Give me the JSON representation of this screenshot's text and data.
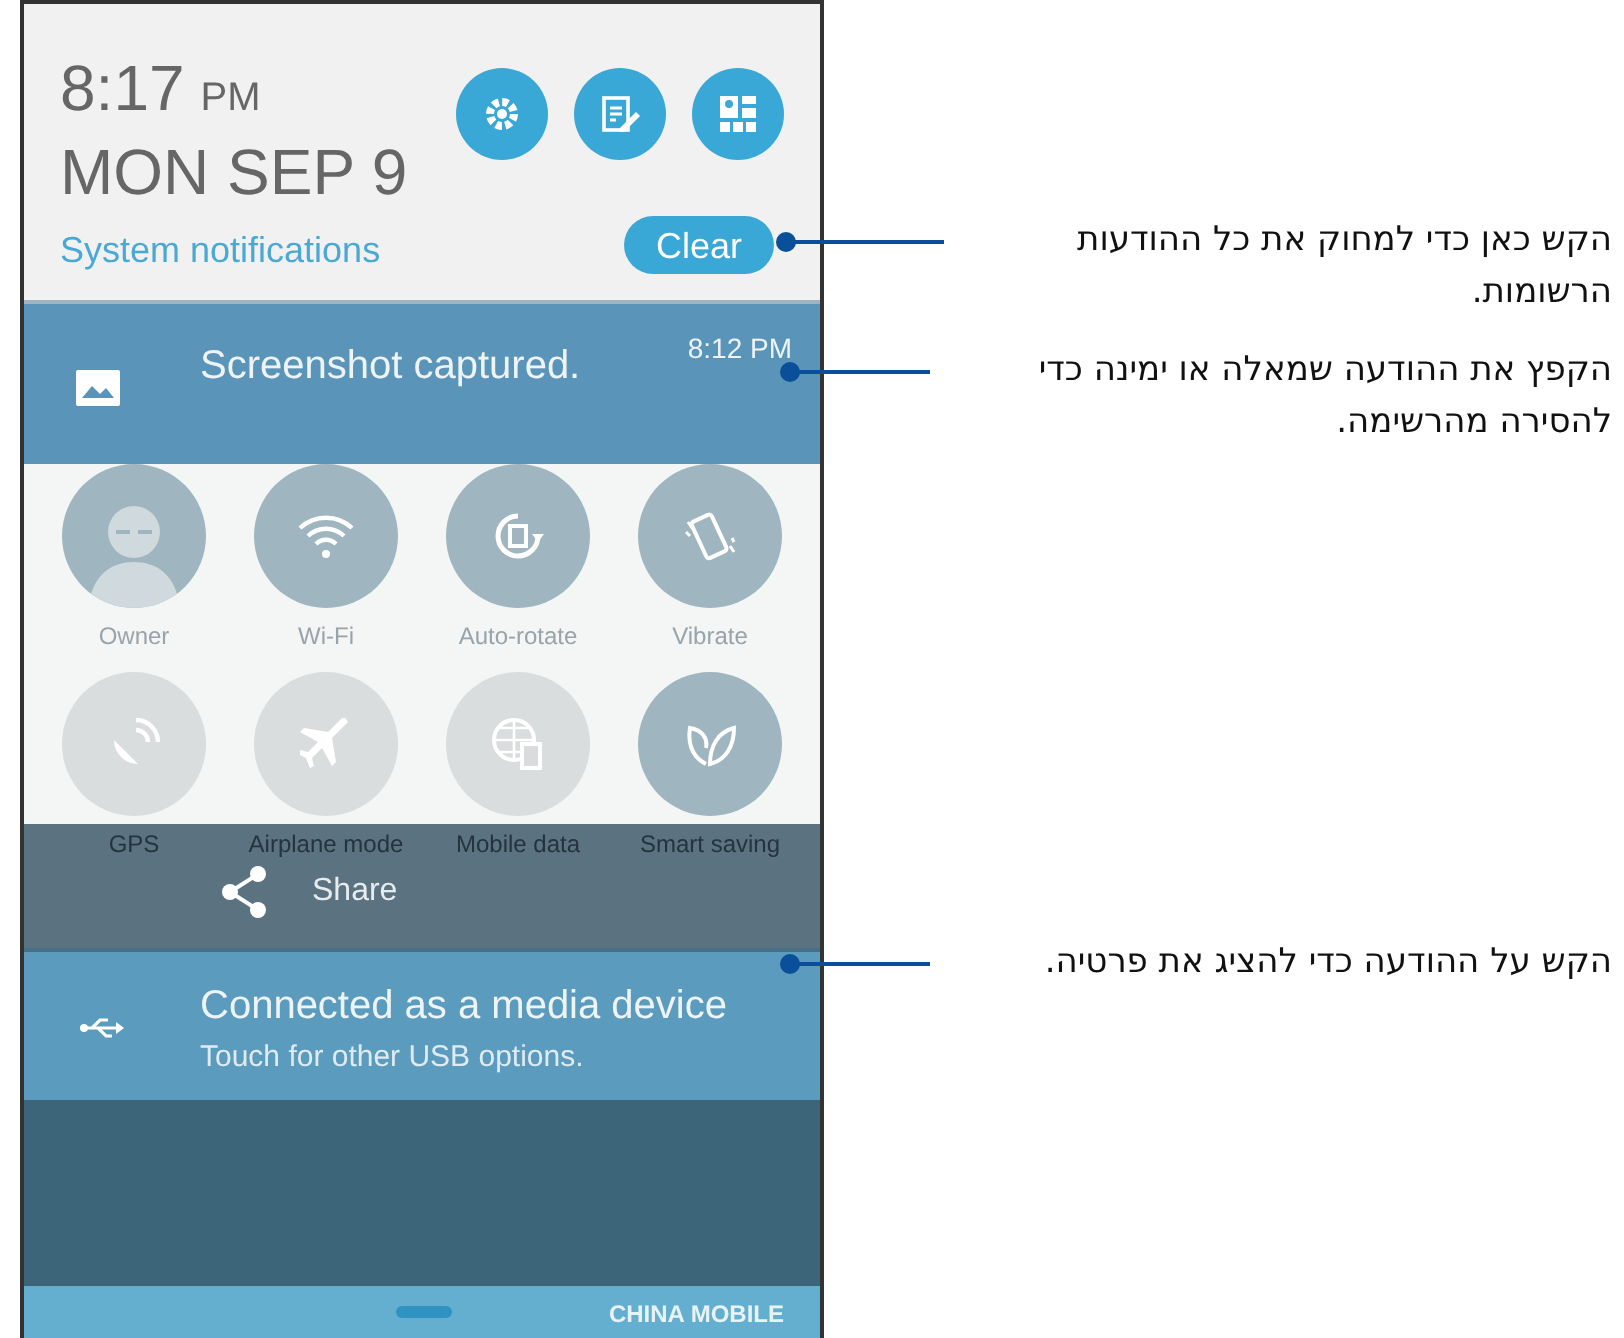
{
  "header": {
    "time": "8:17",
    "ampm": "PM",
    "date": "MON SEP 9",
    "section_label": "System notifications",
    "clear_button": "Clear"
  },
  "screenshot_notification": {
    "title": "Screenshot captured.",
    "time": "8:12 PM"
  },
  "quick_settings": [
    {
      "kind": "owner",
      "label": "Owner",
      "on": true
    },
    {
      "kind": "wifi",
      "label": "Wi-Fi",
      "on": true
    },
    {
      "kind": "rotate",
      "label": "Auto-rotate",
      "on": true
    },
    {
      "kind": "vibrate",
      "label": "Vibrate",
      "on": true
    },
    {
      "kind": "gps",
      "label": "GPS",
      "on": false
    },
    {
      "kind": "airplane",
      "label": "Airplane mode",
      "on": false
    },
    {
      "kind": "data",
      "label": "Mobile data",
      "on": false
    },
    {
      "kind": "leaf",
      "label": "Smart saving",
      "on": true
    }
  ],
  "share_action": {
    "label": "Share"
  },
  "usb_notification": {
    "title": "Connected as a media device",
    "subtitle": "Touch for other USB options."
  },
  "bottom_bar": {
    "carrier": "CHINA MOBILE"
  },
  "callouts": [
    {
      "text": "הקש כאן כדי למחוק את כל ההודעות הרשומות."
    },
    {
      "text": "הקפץ את ההודעה שמאלה או ימינה כדי להסירה מהרשימה."
    },
    {
      "text": "הקש על ההודעה כדי להציג את פרטיה."
    }
  ]
}
